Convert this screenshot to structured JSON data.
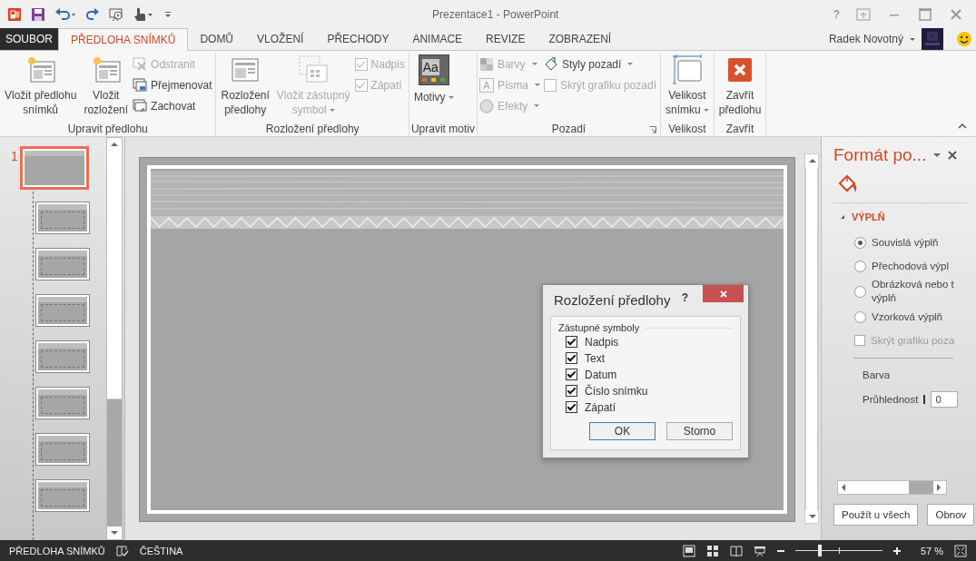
{
  "window": {
    "title": "Prezentace1 - PowerPoint",
    "help": "?"
  },
  "tabs": [
    {
      "label": "SOUBOR",
      "kind": "file",
      "selected": false
    },
    {
      "label": "PŘEDLOHA SNÍMKŮ",
      "kind": "tab",
      "selected": true
    },
    {
      "label": "DOMŮ",
      "kind": "tab",
      "selected": false
    },
    {
      "label": "VLOŽENÍ",
      "kind": "tab",
      "selected": false
    },
    {
      "label": "PŘECHODY",
      "kind": "tab",
      "selected": false
    },
    {
      "label": "ANIMACE",
      "kind": "tab",
      "selected": false
    },
    {
      "label": "REVIZE",
      "kind": "tab",
      "selected": false
    },
    {
      "label": "ZOBRAZENÍ",
      "kind": "tab",
      "selected": false
    }
  ],
  "user": {
    "name": "Radek Novotný"
  },
  "ribbon": {
    "groups": [
      {
        "label": "Upravit předlohu",
        "columns": [
          [
            {
              "kind": "large",
              "label": "Vložit předlohu\nsnímků",
              "disabled": false,
              "dropdown": false
            }
          ],
          [
            {
              "kind": "large",
              "label": "Vložit\nrozložení",
              "disabled": false,
              "dropdown": false
            }
          ],
          [
            {
              "kind": "small",
              "label": "Odstranit",
              "disabled": true,
              "dropdown": false
            },
            {
              "kind": "small",
              "label": "Přejmenovat",
              "disabled": false,
              "dropdown": false
            },
            {
              "kind": "small",
              "label": "Zachovat",
              "disabled": false,
              "dropdown": false
            }
          ]
        ]
      },
      {
        "label": "Rozložení předlohy",
        "columns": [
          [
            {
              "kind": "large",
              "label": "Rozložení\npředlohy",
              "disabled": false,
              "dropdown": false
            }
          ],
          [
            {
              "kind": "large",
              "label": "Vložit zástupný\nsymbol",
              "disabled": true,
              "dropdown": true
            }
          ],
          [
            {
              "kind": "check",
              "label": "Nadpis",
              "disabled": true,
              "checked": true
            },
            {
              "kind": "check",
              "label": "Zápatí",
              "disabled": true,
              "checked": true
            }
          ]
        ]
      },
      {
        "label": "Upravit motiv",
        "columns": [
          [
            {
              "kind": "large",
              "label": "Motivy",
              "icon_text": "Aa",
              "disabled": false,
              "dropdown": true
            }
          ]
        ]
      },
      {
        "label": "Pozadí",
        "launcher": true,
        "columns": [
          [
            {
              "kind": "small",
              "label": "Barvy",
              "disabled": true,
              "dropdown": true
            },
            {
              "kind": "small",
              "label": "Písma",
              "icon_text": "A",
              "disabled": true,
              "dropdown": true
            },
            {
              "kind": "small",
              "label": "Efekty",
              "disabled": true,
              "dropdown": true
            }
          ],
          [
            {
              "kind": "small",
              "label": "Styly pozadí",
              "disabled": false,
              "dropdown": true
            },
            {
              "kind": "check",
              "label": "Skrýt grafiku pozadí",
              "disabled": true,
              "checked": false
            }
          ]
        ]
      },
      {
        "label": "Velikost",
        "columns": [
          [
            {
              "kind": "large",
              "label": "Velikost\nsnímku",
              "disabled": false,
              "dropdown": true
            }
          ]
        ]
      },
      {
        "label": "Zavřít",
        "columns": [
          [
            {
              "kind": "large",
              "label": "Zavřít\npředlohu",
              "disabled": false,
              "dropdown": false
            }
          ]
        ]
      }
    ]
  },
  "thumbnails": [
    {
      "kind": "master",
      "number": "1",
      "selected": true
    },
    {
      "kind": "layout",
      "selected": false
    },
    {
      "kind": "layout",
      "selected": false
    },
    {
      "kind": "layout",
      "selected": false
    },
    {
      "kind": "layout",
      "selected": false
    },
    {
      "kind": "layout",
      "selected": false
    },
    {
      "kind": "layout",
      "selected": false
    },
    {
      "kind": "layout",
      "selected": false
    }
  ],
  "dialog": {
    "title": "Rozložení předlohy",
    "help": "?",
    "group": "Zástupné symboly",
    "options": [
      {
        "label": "Nadpis",
        "checked": true
      },
      {
        "label": "Text",
        "checked": true
      },
      {
        "label": "Datum",
        "checked": true
      },
      {
        "label": "Číslo snímku",
        "checked": true
      },
      {
        "label": "Zápatí",
        "checked": true
      }
    ],
    "buttons": [
      {
        "label": "OK",
        "default": true
      },
      {
        "label": "Storno",
        "default": false
      }
    ]
  },
  "format_pane": {
    "title": "Formát po...",
    "section": {
      "label": "VÝPLŇ",
      "expanded": true
    },
    "fills": [
      {
        "label": "Souvislá výplň",
        "selected": true
      },
      {
        "label": "Přechodová výpl",
        "selected": false
      },
      {
        "label": "Obrázková nebo t\nvýplň",
        "selected": false
      },
      {
        "label": "Vzorková výplň",
        "selected": false
      }
    ],
    "hide_graphics": {
      "label": "Skrýt grafiku poza",
      "checked": false
    },
    "color_label": "Barva",
    "transparency": {
      "label": "Průhlednost",
      "value": "0"
    },
    "buttons": [
      "Použít u všech",
      "Obnov"
    ]
  },
  "status_bar": {
    "mode": "PŘEDLOHA SNÍMKŮ",
    "language": "ČEŠTINA",
    "zoom_slider": {
      "level": 0.28
    },
    "zoom": "57 %"
  }
}
